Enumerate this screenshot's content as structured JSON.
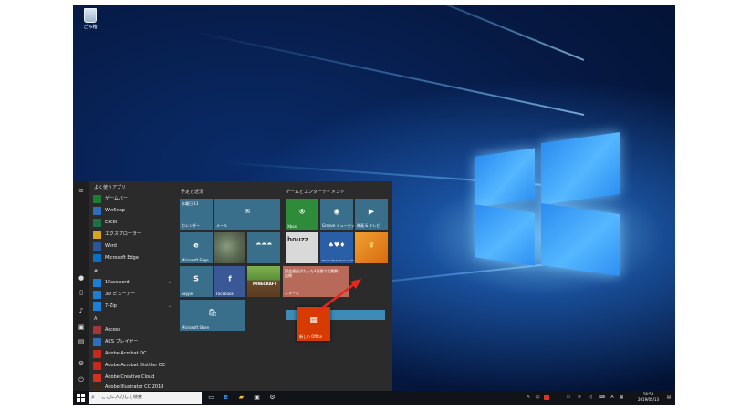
{
  "desktop": {
    "recycle_bin_label": "ごみ箱"
  },
  "start_menu": {
    "apps_header": "よく使うアプリ",
    "frequent_apps": [
      {
        "label": "ゲームバー",
        "icon": "game-bar-icon",
        "color": "#1e7d32"
      },
      {
        "label": "WinSnap",
        "icon": "winsnap-icon",
        "color": "#2d6fb8"
      },
      {
        "label": "Excel",
        "icon": "excel-icon",
        "color": "#1e7145"
      },
      {
        "label": "エクスプローラー",
        "icon": "file-explorer-icon",
        "color": "#d8a521"
      },
      {
        "label": "Word",
        "icon": "word-icon",
        "color": "#2b579a"
      },
      {
        "label": "Microsoft Edge",
        "icon": "edge-icon",
        "color": "#0a6fc7"
      }
    ],
    "section_hash": "#",
    "hash_apps": [
      {
        "label": "1Password",
        "icon": "1password-icon",
        "color": "#1c7fd4",
        "expand": "⌄"
      },
      {
        "label": "3D ビューアー",
        "icon": "3d-viewer-icon",
        "color": "#1c7fd4",
        "expand": ""
      },
      {
        "label": "7-Zip",
        "icon": "7zip-icon",
        "color": "#1c7fd4",
        "expand": "⌄"
      }
    ],
    "section_a": "A",
    "a_apps": [
      {
        "label": "Access",
        "icon": "access-icon",
        "color": "#a4373a"
      },
      {
        "label": "ACS プレイヤー",
        "icon": "acs-player-icon",
        "color": "#2d6fb8"
      },
      {
        "label": "Adobe Acrobat DC",
        "icon": "acrobat-icon",
        "color": "#c8281c"
      },
      {
        "label": "Adobe Acrobat Distiller DC",
        "icon": "distiller-icon",
        "color": "#c8281c"
      },
      {
        "label": "Adobe Creative Cloud",
        "icon": "creative-cloud-icon",
        "color": "#d4301f"
      },
      {
        "label": "Adobe Illustrator CC 2018",
        "icon": "illustrator-icon",
        "color": "#3a2a15"
      }
    ],
    "tiles_section_1": "予定と近況",
    "tiles_section_2": "ゲームとエンターテイメント",
    "tiles": {
      "calendar": {
        "label": "カレンダー",
        "sub": "水曜日 13",
        "color": "#3a6f8c"
      },
      "mail": {
        "label": "メール",
        "color": "#3a6f8c"
      },
      "edge": {
        "label": "Microsoft Edge",
        "color": "#3a6f8c"
      },
      "photos": {
        "label": "",
        "color": "#6b7a64"
      },
      "weather": {
        "label": "",
        "color": "#3a6f8c"
      },
      "skype": {
        "label": "Skype",
        "color": "#3a6f8c"
      },
      "facebook": {
        "label": "Facebook",
        "color": "#3a5896"
      },
      "minecraft": {
        "label": "MINECRAFT",
        "color": "#5a8f3a"
      },
      "news": {
        "label": "ニュース",
        "sub": "国会議員がたった4日間で北朝鮮訪問",
        "color": "#b86a5a"
      },
      "store": {
        "label": "Microsoft Store",
        "color": "#3a6f8c"
      },
      "xbox": {
        "label": "Xbox",
        "color": "#2e8b3a"
      },
      "groove": {
        "label": "Groove ミュージック",
        "color": "#3a6f8c"
      },
      "movies": {
        "label": "映画 & テレビ",
        "color": "#3a6f8c"
      },
      "houzz": {
        "label": "houzz",
        "color": "#d9d9d9"
      },
      "solitaire": {
        "label": "Microsoft Solitaire Collection",
        "color": "#2a5fa8"
      },
      "king": {
        "label": "",
        "color": "#e87d1e"
      },
      "office": {
        "label": "新しい Office",
        "color": "#d83b01"
      },
      "drop_target": {
        "label": "",
        "color": "#3e8bb8"
      }
    },
    "rail_icons": [
      "hamburger-icon",
      "user-icon",
      "documents-icon",
      "pictures-icon",
      "settings-icon",
      "power-icon",
      "music-icon",
      "video-icon"
    ]
  },
  "taskbar": {
    "search_placeholder": "ここに入力して検索",
    "time": "18:58",
    "date": "2019/05/13"
  },
  "annotation": {
    "arrow_color": "#e8281f"
  }
}
